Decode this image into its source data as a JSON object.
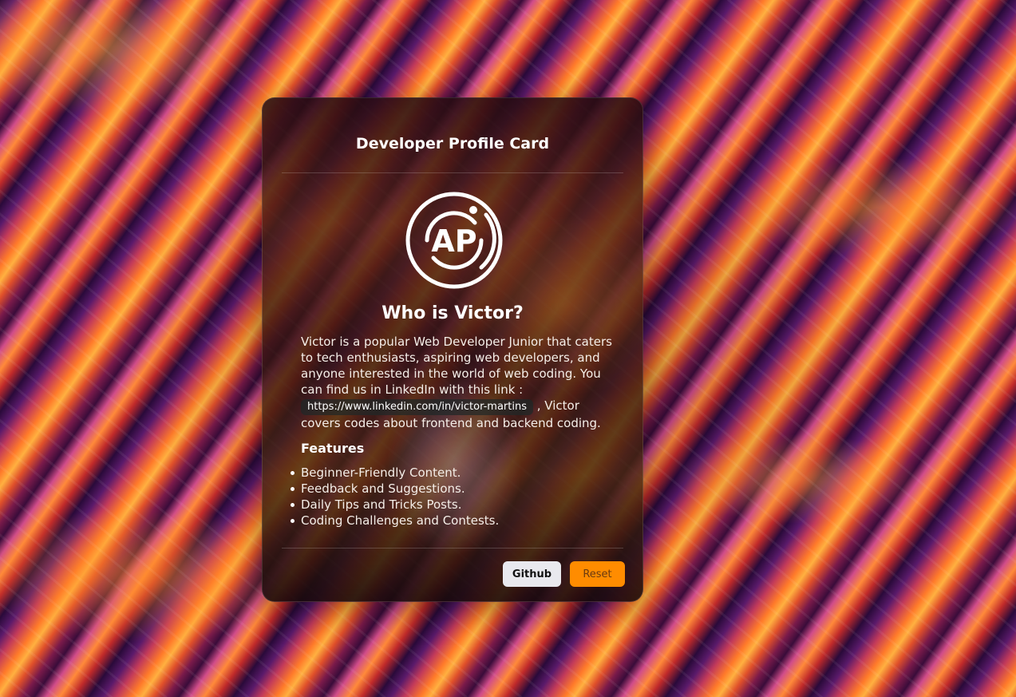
{
  "card": {
    "title": "Developer Profile Card",
    "logo_text": "AP",
    "heading": "Who is Victor?",
    "description_part1": "Victor is a popular Web Developer Junior that caters to tech enthusiasts, aspiring web developers, and anyone interested in the world of web coding. You can find us in LinkedIn with this link :",
    "link": "https://www.linkedin.com/in/victor-martins",
    "description_part2": ", Victor covers codes about frontend and backend coding.",
    "features_title": "Features",
    "features": [
      "Beginner-Friendly Content.",
      "Feedback and Suggestions.",
      "Daily Tips and Tricks Posts.",
      "Coding Challenges and Contests."
    ]
  },
  "buttons": {
    "github": "Github",
    "reset": "Reset"
  },
  "colors": {
    "reset_button": "#ff8c00",
    "github_button": "#e9e9ee"
  }
}
